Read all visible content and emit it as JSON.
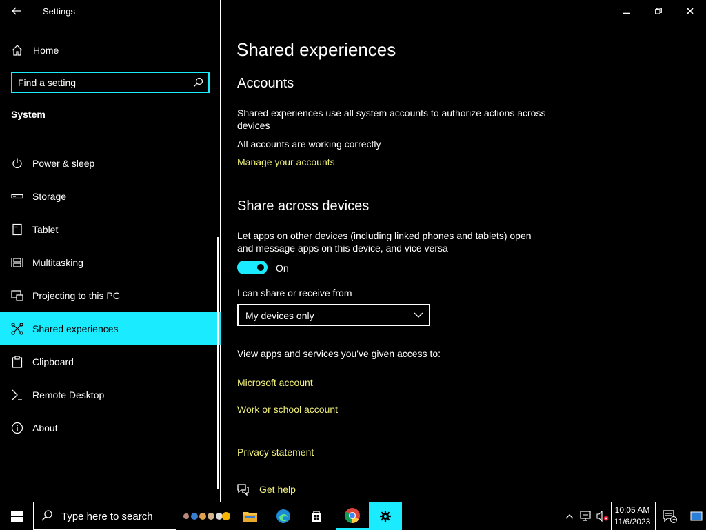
{
  "window": {
    "app_title": "Settings",
    "caption_buttons": [
      "minimize",
      "restore",
      "close"
    ]
  },
  "sidebar": {
    "home_label": "Home",
    "search_placeholder": "Find a setting",
    "section_title": "System",
    "items": [
      {
        "label": "Power & sleep",
        "icon": "power-icon"
      },
      {
        "label": "Storage",
        "icon": "storage-icon"
      },
      {
        "label": "Tablet",
        "icon": "tablet-icon"
      },
      {
        "label": "Multitasking",
        "icon": "multitasking-icon"
      },
      {
        "label": "Projecting to this PC",
        "icon": "projecting-icon"
      },
      {
        "label": "Shared experiences",
        "icon": "shared-experiences-icon",
        "selected": true
      },
      {
        "label": "Clipboard",
        "icon": "clipboard-icon"
      },
      {
        "label": "Remote Desktop",
        "icon": "remote-desktop-icon"
      },
      {
        "label": "About",
        "icon": "about-icon"
      }
    ]
  },
  "main": {
    "page_title": "Shared experiences",
    "accounts": {
      "heading": "Accounts",
      "description": "Shared experiences use all system accounts to authorize actions across devices",
      "status": "All accounts are working correctly",
      "manage_link": "Manage your accounts"
    },
    "share": {
      "heading": "Share across devices",
      "description": "Let apps on other devices (including linked phones and tablets) open and message apps on this device, and vice versa",
      "toggle_state": "On",
      "receive_label": "I can share or receive from",
      "receive_value": "My devices only",
      "access_label": "View apps and services you've given access to:",
      "microsoft_link": "Microsoft account",
      "work_link": "Work or school account"
    },
    "privacy_link": "Privacy statement",
    "help_link": "Get help"
  },
  "taskbar": {
    "search_label": "Type here to search",
    "time": "10:05 AM",
    "date": "11/6/2023",
    "notification_count": "1",
    "apps": [
      "file-explorer",
      "edge",
      "store",
      "chrome",
      "settings"
    ]
  },
  "colors": {
    "accent": "#1aebff",
    "link": "#f0f07a",
    "background": "#000000",
    "text": "#ffffff"
  }
}
